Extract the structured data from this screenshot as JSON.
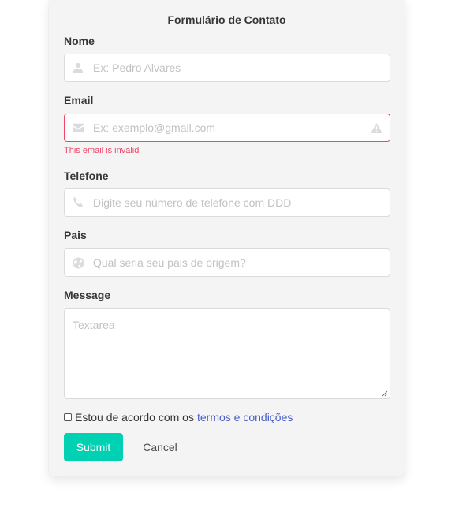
{
  "form": {
    "title": "Formulário de Contato",
    "fields": {
      "name": {
        "label": "Nome",
        "placeholder": "Ex: Pedro Alvares",
        "icon": "user-icon"
      },
      "email": {
        "label": "Email",
        "placeholder": "Ex: exemplo@gmail.com",
        "icon": "envelope-icon",
        "status_icon": "warning-icon",
        "error": "This email is invalid",
        "state_color": "#f14668"
      },
      "phone": {
        "label": "Telefone",
        "placeholder": "Digite seu número de telefone com DDD",
        "icon": "phone-icon"
      },
      "country": {
        "label": "Pais",
        "placeholder": "Qual seria seu pais de origem?",
        "icon": "globe-icon"
      },
      "message": {
        "label": "Message",
        "placeholder": "Textarea"
      }
    },
    "terms": {
      "text": "Estou de acordo com os",
      "link": "termos e condições",
      "checked": false
    },
    "submit_label": "Submit",
    "cancel_label": "Cancel"
  },
  "colors": {
    "primary": "#00d1b2",
    "danger": "#f14668",
    "link": "#485fc7",
    "card_bg": "#f4f4f4"
  }
}
